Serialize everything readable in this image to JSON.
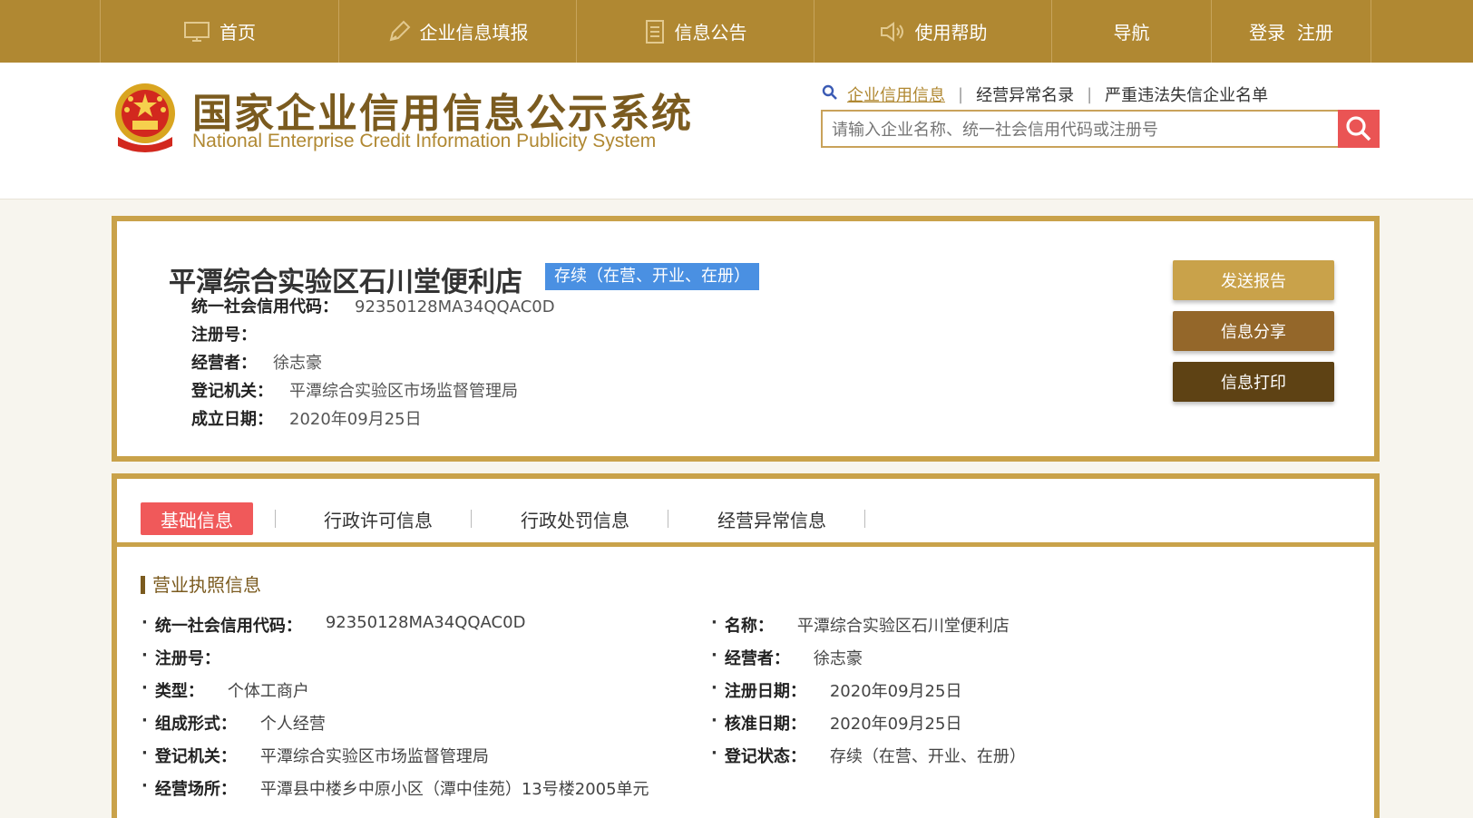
{
  "nav": {
    "items": [
      {
        "label": "首页",
        "icon": "monitor-icon"
      },
      {
        "label": "企业信息填报",
        "icon": "pen-icon"
      },
      {
        "label": "信息公告",
        "icon": "document-icon"
      },
      {
        "label": "使用帮助",
        "icon": "speaker-icon"
      },
      {
        "label": "导航",
        "icon": ""
      },
      {
        "label": "登录  注册",
        "icon": ""
      }
    ]
  },
  "header": {
    "title": "国家企业信用信息公示系统",
    "subtitle": "National Enterprise Credit Information Publicity System",
    "search_links": [
      "企业信用信息",
      "经营异常名录",
      "严重违法失信企业名单"
    ],
    "search_placeholder": "请输入企业名称、统一社会信用代码或注册号"
  },
  "enterprise": {
    "name": "平潭综合实验区石川堂便利店",
    "status": "存续（在营、开业、在册）",
    "fields": [
      {
        "label": "统一社会信用代码：",
        "value": "92350128MA34QQAC0D"
      },
      {
        "label": "注册号：",
        "value": ""
      },
      {
        "label": "经营者：",
        "value": "徐志豪"
      },
      {
        "label": "登记机关：",
        "value": "平潭综合实验区市场监督管理局"
      },
      {
        "label": "成立日期：",
        "value": "2020年09月25日"
      }
    ],
    "buttons": [
      {
        "label": "发送报告",
        "color": "#c9a24a"
      },
      {
        "label": "信息分享",
        "color": "#94672a"
      },
      {
        "label": "信息打印",
        "color": "#5e4214"
      }
    ]
  },
  "tabs": [
    "基础信息",
    "行政许可信息",
    "行政处罚信息",
    "经营异常信息"
  ],
  "license": {
    "section_title": "营业执照信息",
    "left": [
      {
        "label": "统一社会信用代码：",
        "value": "92350128MA34QQAC0D"
      },
      {
        "label": "注册号：",
        "value": ""
      },
      {
        "label": "类型：",
        "value": "个体工商户"
      },
      {
        "label": "组成形式：",
        "value": "个人经营"
      },
      {
        "label": "登记机关：",
        "value": "平潭综合实验区市场监督管理局"
      },
      {
        "label": "经营场所：",
        "value": "平潭县中楼乡中原小区（潭中佳苑）13号楼2005单元"
      }
    ],
    "right": [
      {
        "label": "名称：",
        "value": "平潭综合实验区石川堂便利店"
      },
      {
        "label": "经营者：",
        "value": "徐志豪"
      },
      {
        "label": "注册日期：",
        "value": "2020年09月25日"
      },
      {
        "label": "核准日期：",
        "value": "2020年09月25日"
      },
      {
        "label": "登记状态：",
        "value": "存续（在营、开业、在册）"
      }
    ]
  }
}
